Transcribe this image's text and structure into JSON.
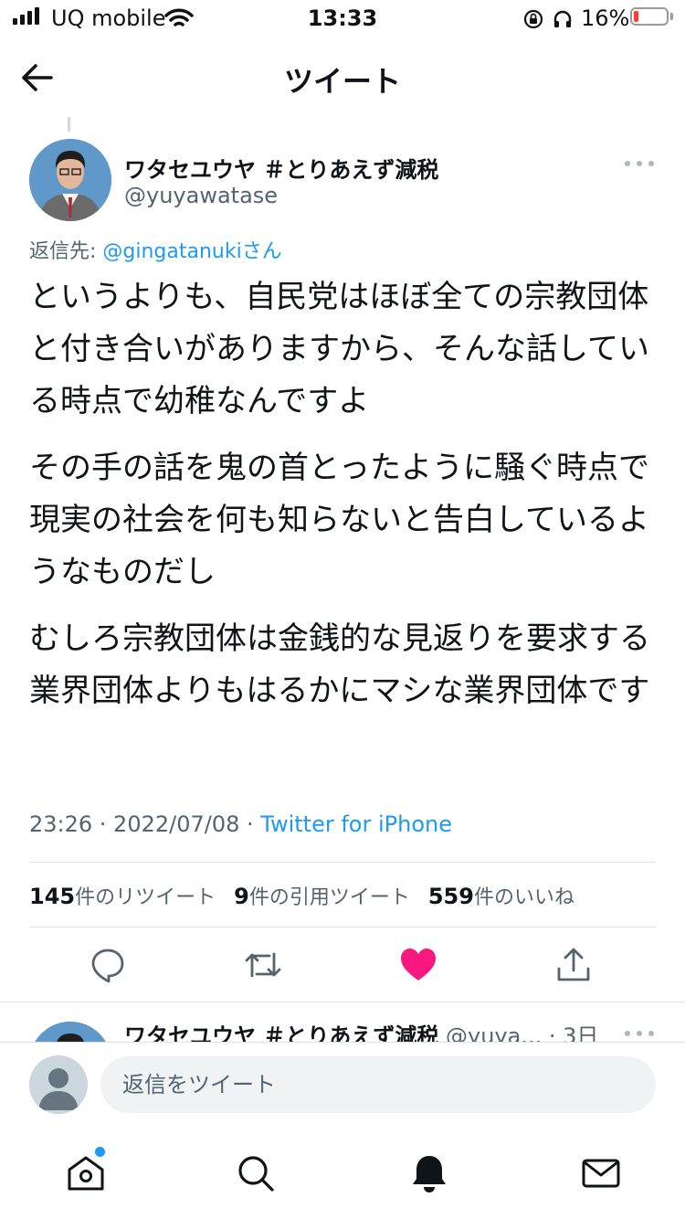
{
  "status_bar": {
    "carrier": "UQ mobile",
    "time": "13:33",
    "battery": "16%",
    "battery_level": 0.16,
    "battery_color": "#ff3b30"
  },
  "nav": {
    "title": "ツイート",
    "back_icon": "arrow-left-icon"
  },
  "tweet": {
    "author_name": "ワタセユウヤ ＃とりあえず減税",
    "author_handle": "@yuyawatase",
    "reply_prefix": "返信先: ",
    "reply_mention": "@gingatanuki",
    "reply_suffix": "さん",
    "paragraphs": [
      "というよりも、自民党はほぼ全ての宗教団体と付き合いがありますから、そんな話している時点で幼稚なんですよ",
      "その手の話を鬼の首とったように騒ぐ時点で現実の社会を何も知らないと告白しているようなものだし",
      "むしろ宗教団体は金銭的な見返りを要求する業界団体よりもはるかにマシな業界団体です"
    ],
    "timestamp": "23:26 · 2022/07/08 · ",
    "source": "Twitter for iPhone",
    "stats": {
      "retweets_count": "145",
      "retweets_label": "件のリツイート",
      "quotes_count": "9",
      "quotes_label": "件の引用ツイート",
      "likes_count": "559",
      "likes_label": "件のいいね"
    },
    "actions": [
      "reply-icon",
      "retweet-icon",
      "like-icon",
      "share-icon"
    ],
    "liked": true,
    "like_color": "#f91880"
  },
  "next_tweet": {
    "author_name": "ワタセユウヤ ＃とりあえず減税",
    "author_handle_truncated": " @yuya...",
    "age": " · 3日"
  },
  "reply_bar": {
    "placeholder": "返信をツイート"
  },
  "tab_bar": {
    "items": [
      "home-icon",
      "search-icon",
      "notifications-icon",
      "messages-icon"
    ],
    "home_has_badge": true,
    "accent": "#1d9bf0"
  }
}
